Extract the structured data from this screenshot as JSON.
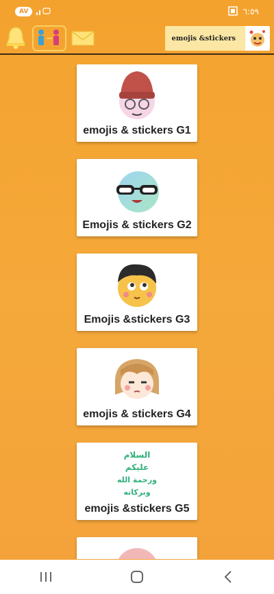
{
  "status_bar": {
    "badge": "AV",
    "time": "٦:٥٩"
  },
  "header": {
    "toolbar_icons": [
      "bell-icon",
      "share-people-icon",
      "mail-icon"
    ],
    "brand_label": "emojis &stickers"
  },
  "cards": [
    {
      "label": "emojis & stickers G1",
      "art": "emoji-knit-hat-glasses"
    },
    {
      "label": "Emojis & stickers G2",
      "art": "emoji-glasses-smile"
    },
    {
      "label": "Emojis &stickers G3",
      "art": "emoji-boy-face"
    },
    {
      "label": "emojis & stickers  G4",
      "art": "emoji-girl-face"
    },
    {
      "label": "emojis &stickers G5",
      "art": "arabic-greeting-text",
      "art_text": [
        "السلام",
        "عليكم",
        "ورحمة الله",
        "وبركاته"
      ]
    },
    {
      "label": "",
      "art": "emoji-partial"
    }
  ],
  "nav": {
    "buttons": [
      "recent-apps-icon",
      "home-icon",
      "back-icon"
    ]
  },
  "colors": {
    "background": "#f4a22e",
    "card": "#ffffff",
    "text": "#222222"
  }
}
